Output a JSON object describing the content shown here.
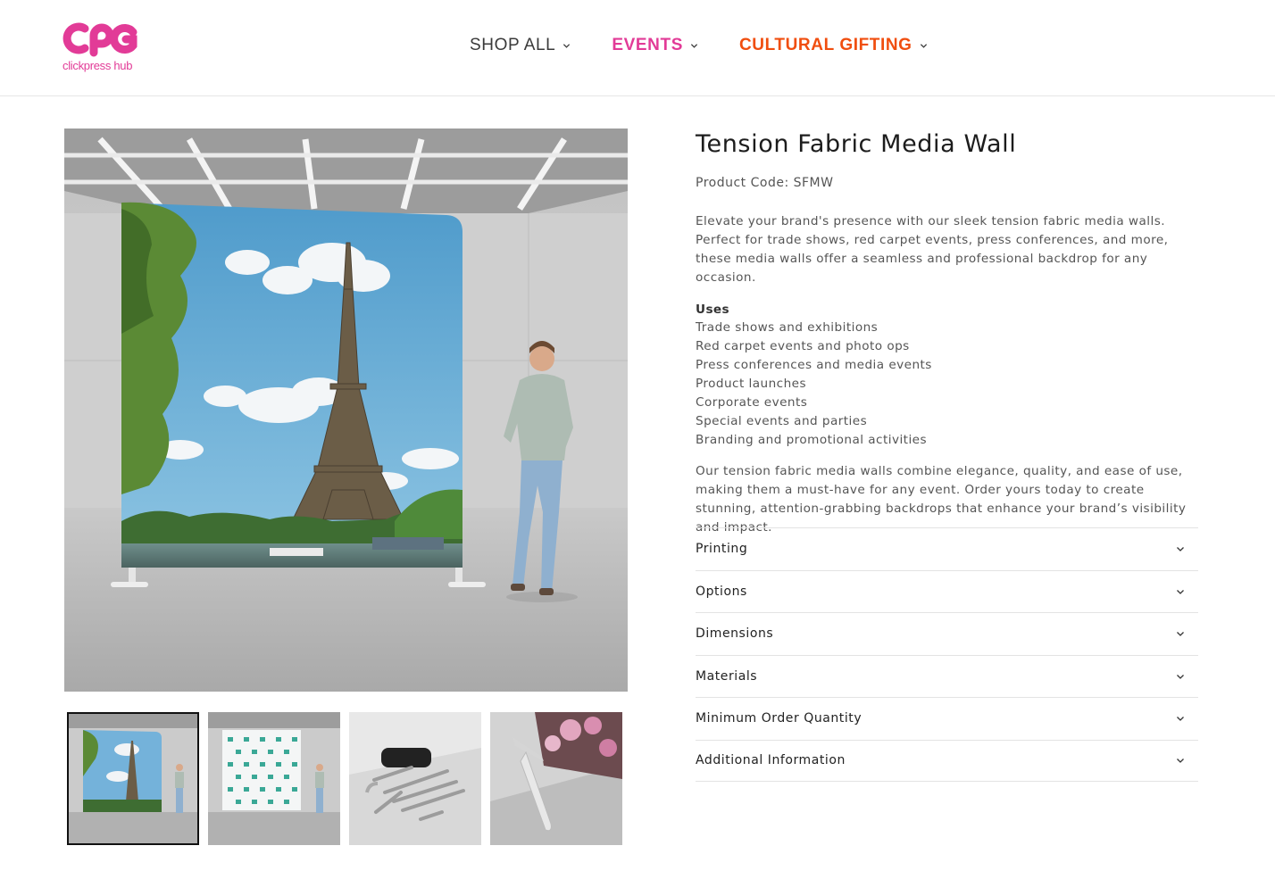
{
  "brand": {
    "logo_letters": "CPG",
    "logo_tagline": "clickpress hub",
    "pink": "#e23b97",
    "orange": "#f04e0f"
  },
  "nav": {
    "items": [
      {
        "label": "SHOP ALL",
        "icon": "chevron-down-icon"
      },
      {
        "label": "EVENTS",
        "icon": "chevron-down-icon"
      },
      {
        "label": "CULTURAL GIFTING",
        "icon": "chevron-down-icon"
      }
    ]
  },
  "gallery": {
    "main_image": "tension-fabric-media-wall-eiffel-tower-with-man",
    "thumbnails": [
      {
        "name": "eiffel-tower-wall-thumbnail",
        "active": true
      },
      {
        "name": "step-and-repeat-wall-thumbnail",
        "active": false
      },
      {
        "name": "frame-kit-bag-thumbnail",
        "active": false
      },
      {
        "name": "feet-detail-thumbnail",
        "active": false
      }
    ]
  },
  "product": {
    "title": "Tension Fabric Media Wall",
    "code": "Product Code: SFMW",
    "description": "Elevate your brand's presence with our sleek tension fabric media walls. Perfect for trade shows, red carpet events, press conferences, and more, these media walls offer a seamless and professional backdrop for any occasion.",
    "uses_title": "Uses",
    "uses": [
      "Trade shows and exhibitions",
      "Red carpet events and photo ops",
      "Press conferences and media events",
      "Product launches",
      "Corporate events",
      "Special events and parties",
      "Branding and promotional activities"
    ],
    "outro": "Our tension fabric media walls combine elegance, quality, and ease of use, making them a must-have for any event. Order yours today to create stunning, attention-grabbing backdrops that enhance your brand’s visibility and impact."
  },
  "accordion": [
    {
      "label": "Printing"
    },
    {
      "label": "Options"
    },
    {
      "label": "Dimensions"
    },
    {
      "label": "Materials"
    },
    {
      "label": "Minimum Order Quantity"
    },
    {
      "label": "Additional Information"
    }
  ]
}
